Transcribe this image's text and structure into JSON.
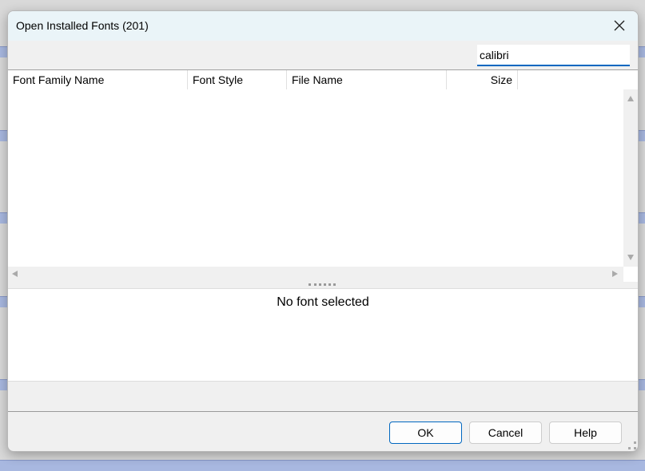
{
  "dialog": {
    "title": "Open Installed Fonts (201)",
    "close_icon": "close-icon"
  },
  "search": {
    "value": "calibri"
  },
  "table": {
    "columns": [
      "Font Family Name",
      "Font Style",
      "File Name",
      "Size"
    ],
    "rows": []
  },
  "preview": {
    "text": "No font selected"
  },
  "buttons": {
    "ok": "OK",
    "cancel": "Cancel",
    "help": "Help"
  },
  "colors": {
    "accent": "#0067c0",
    "titlebar": "#eaf4f8"
  }
}
